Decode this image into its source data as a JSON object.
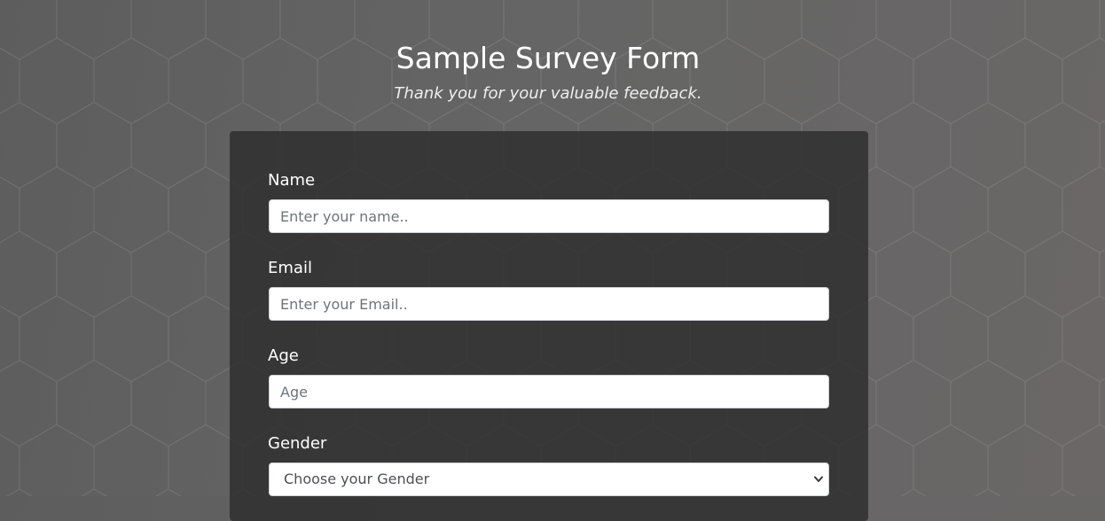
{
  "header": {
    "title": "Sample Survey Form",
    "subtitle": "Thank you for your valuable feedback."
  },
  "form": {
    "name": {
      "label": "Name",
      "placeholder": "Enter your name..",
      "value": ""
    },
    "email": {
      "label": "Email",
      "placeholder": "Enter your Email..",
      "value": ""
    },
    "age": {
      "label": "Age",
      "placeholder": "Age",
      "value": ""
    },
    "gender": {
      "label": "Gender",
      "selected": "Choose your Gender",
      "icon": "chevron-down-icon"
    }
  },
  "colors": {
    "card_background": "#2d2d2d",
    "text": "#ffffff",
    "input_border": "#cfd4d9"
  }
}
